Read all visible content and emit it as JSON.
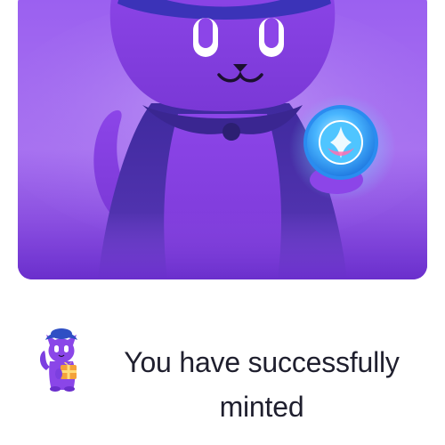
{
  "nft": {
    "image_icon": "wizard-cat-holding-crystal-orb",
    "background_color": "#8f56ea",
    "cat_color": "#8b47e6",
    "cloak_color": "#4b2fa6",
    "orb_color": "#3fb2ff"
  },
  "success": {
    "icon": "wizard-cat-mascot-with-gift",
    "message": "You have successfully minted",
    "text_color": "#1f1f2e"
  }
}
